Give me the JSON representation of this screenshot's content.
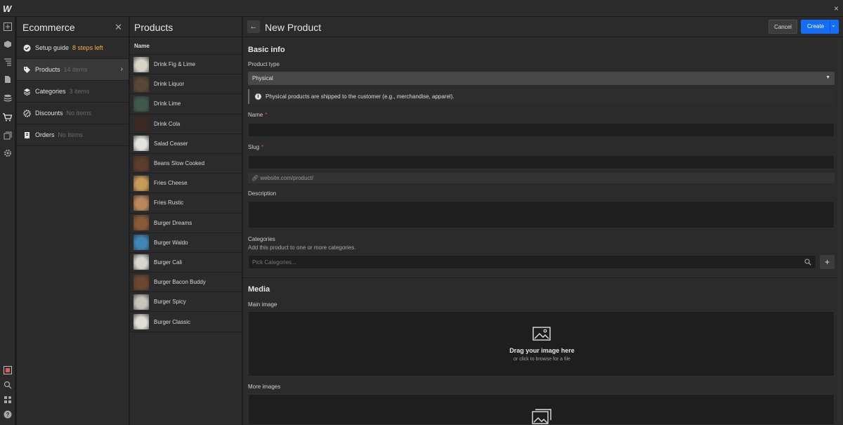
{
  "app": {
    "logo": "W",
    "close_glyph": "×"
  },
  "rail": {
    "icons": [
      "add-icon",
      "box-icon",
      "navigator-icon",
      "pages-icon",
      "cms-icon",
      "ecommerce-icon",
      "assets-icon",
      "settings-icon",
      "record-icon",
      "search-icon",
      "apps-icon",
      "help-icon"
    ]
  },
  "ecommerce": {
    "title": "Ecommerce",
    "items": [
      {
        "label": "Setup guide",
        "meta": "8 steps left",
        "icon": "check-circle-icon"
      },
      {
        "label": "Products",
        "meta": "14 items",
        "icon": "tag-icon"
      },
      {
        "label": "Categories",
        "meta": "3 items",
        "icon": "layers-icon"
      },
      {
        "label": "Discounts",
        "meta": "No items",
        "icon": "discount-icon"
      },
      {
        "label": "Orders",
        "meta": "No items",
        "icon": "receipt-icon"
      }
    ]
  },
  "products": {
    "title": "Products",
    "column_header": "Name",
    "rows": [
      {
        "name": "Drink Fig & Lime",
        "thumb_color": "#d9d6c9"
      },
      {
        "name": "Drink Liquor",
        "thumb_color": "#5a4636"
      },
      {
        "name": "Drink Lime",
        "thumb_color": "#3f5a4d"
      },
      {
        "name": "Drink Cola",
        "thumb_color": "#3a2a22"
      },
      {
        "name": "Salad Ceaser",
        "thumb_color": "#e4e2dc"
      },
      {
        "name": "Beans Slow Cooked",
        "thumb_color": "#5b3d2a"
      },
      {
        "name": "Fries Cheese",
        "thumb_color": "#c79a55"
      },
      {
        "name": "Fries Rustic",
        "thumb_color": "#b9875a"
      },
      {
        "name": "Burger Dreams",
        "thumb_color": "#8a5a38"
      },
      {
        "name": "Burger Waldo",
        "thumb_color": "#3e86b6"
      },
      {
        "name": "Burger Cali",
        "thumb_color": "#d8d5cf"
      },
      {
        "name": "Burger Bacon Buddy",
        "thumb_color": "#6e4630"
      },
      {
        "name": "Burger Spicy",
        "thumb_color": "#c7c4bd"
      },
      {
        "name": "Burger Classic",
        "thumb_color": "#e0ddd6"
      }
    ]
  },
  "form": {
    "title": "New Product",
    "back_glyph": "←",
    "cancel_label": "Cancel",
    "create_label": "Create",
    "basic_info_title": "Basic info",
    "product_type_label": "Product type",
    "product_type_value": "Physical",
    "product_type_notice": "Physical products are shipped to the customer (e.g., merchandise, apparel).",
    "name_label": "Name",
    "name_value": "",
    "slug_label": "Slug",
    "slug_value": "",
    "slug_hint": "website.com/product/",
    "description_label": "Description",
    "description_value": "",
    "categories_label": "Categories",
    "categories_help": "Add this product to one or more categories.",
    "categories_placeholder": "Pick Categories...",
    "required_mark": "*",
    "media_title": "Media",
    "main_image_label": "Main image",
    "drop_title": "Drag your image here",
    "drop_sub": "or click to browse for a file",
    "more_images_label": "More images"
  },
  "colors": {
    "accent": "#146ef5",
    "warning": "#f2b63c",
    "required": "#e94f4f"
  }
}
